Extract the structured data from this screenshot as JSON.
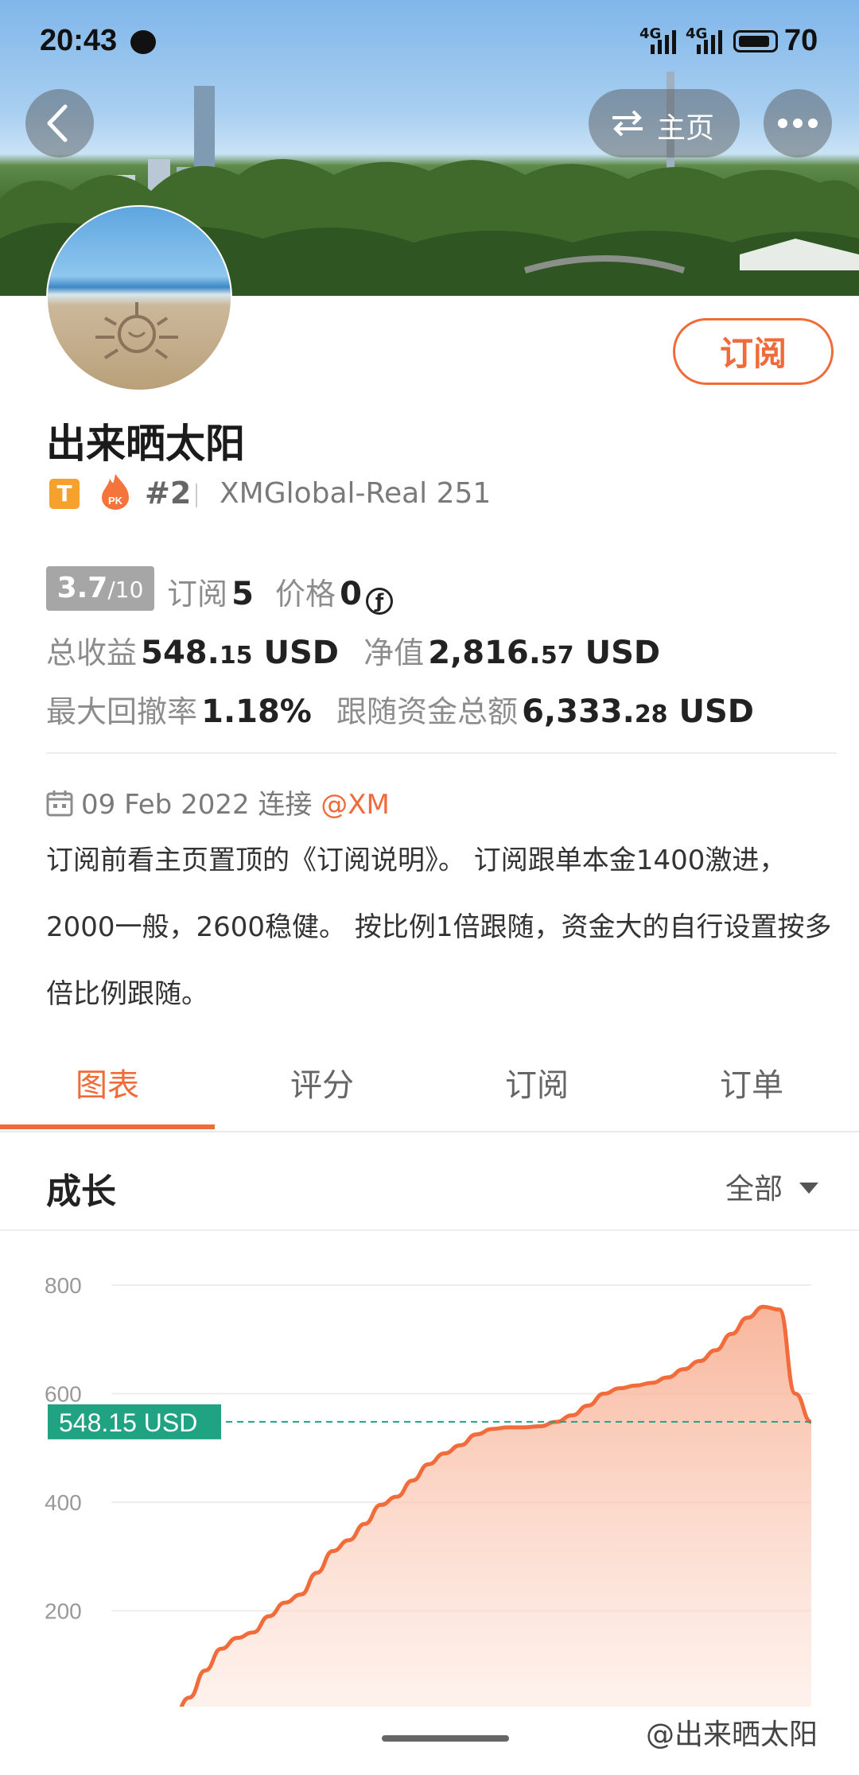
{
  "status_bar": {
    "time": "20:43",
    "signal_1": "4G",
    "signal_2": "4G",
    "battery": "70"
  },
  "header": {
    "home_label": "主页",
    "home_icon": "swap-arrows-icon",
    "back_icon": "chevron-left-icon",
    "more_icon": "more-dots-icon"
  },
  "profile": {
    "name": "出来晒太阳",
    "badge_letter": "T",
    "rank": "#2",
    "account": "XMGlobal-Real 251",
    "subscribe_label": "订阅"
  },
  "stats": {
    "score": "3.7",
    "score_den": "/10",
    "subs_label": "订阅",
    "subs_value": "5",
    "price_label": "价格",
    "price_value": "0",
    "profit_label": "总收益",
    "profit_int": "548.",
    "profit_dec": "15",
    "profit_unit": " USD",
    "equity_label": "净值",
    "equity_int": "2,816.",
    "equity_dec": "57",
    "equity_unit": " USD",
    "drawdown_label": "最大回撤率",
    "drawdown_value": "1.18%",
    "follow_label": "跟随资金总额",
    "follow_int": "6,333.",
    "follow_dec": "28",
    "follow_unit": " USD"
  },
  "joined": {
    "date": "09 Feb 2022 连接",
    "broker": "@XM"
  },
  "description": "订阅前看主页置顶的《订阅说明》。 订阅跟单本金1400激进，2000一般，2600稳健。 按比例1倍跟随，资金大的自行设置按多倍比例跟随。",
  "tabs": [
    {
      "label": "图表"
    },
    {
      "label": "评分"
    },
    {
      "label": "订阅"
    },
    {
      "label": "订单"
    }
  ],
  "section": {
    "title": "成长",
    "range": "全部"
  },
  "chart_data": {
    "type": "area",
    "y_ticks": [
      "800",
      "600",
      "400",
      "200"
    ],
    "ylim": [
      0,
      800
    ],
    "current_label": "548.15 USD",
    "current_value": 548.15,
    "values": [
      5,
      40,
      90,
      130,
      150,
      160,
      190,
      215,
      230,
      270,
      310,
      330,
      360,
      395,
      410,
      440,
      470,
      490,
      505,
      525,
      535,
      538,
      538,
      540,
      548,
      560,
      578,
      600,
      610,
      615,
      620,
      630,
      645,
      660,
      680,
      710,
      740,
      760,
      755,
      600,
      548
    ]
  },
  "watermark": "@出来晒太阳"
}
